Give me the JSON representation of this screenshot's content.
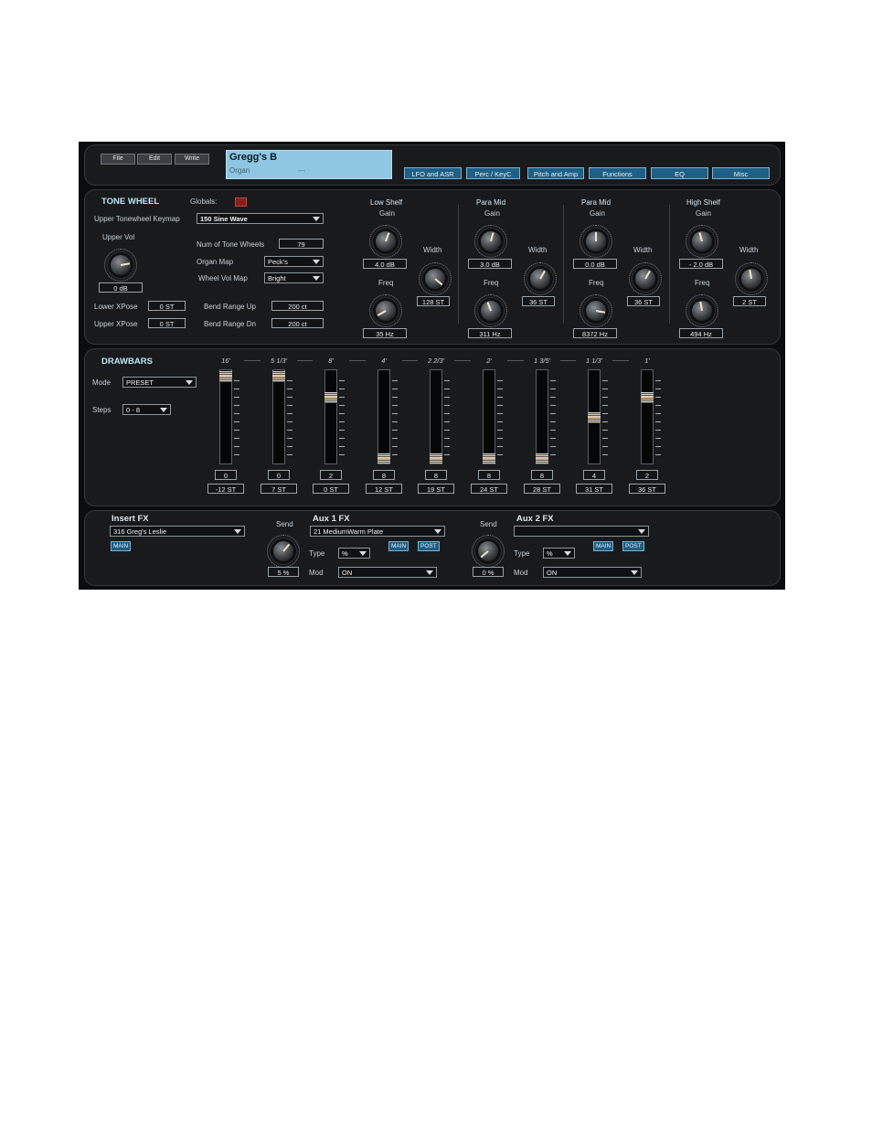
{
  "toolbar": {
    "file": "File",
    "edit": "Edit",
    "write": "Write",
    "patch_name": "Gregg's B",
    "patch_category": "Organ",
    "patch_extra": "---",
    "tabs": [
      "LFO and ASR",
      "Perc / KeyC",
      "Pitch and Amp",
      "Functions",
      "EQ",
      "Misc"
    ]
  },
  "tone_wheel": {
    "title": "TONE WHEEL",
    "globals": "Globals:",
    "keymap_label": "Upper Tonewheel Keymap",
    "keymap_value": "150 Sine Wave",
    "upper_vol_label": "Upper Vol",
    "upper_vol_value": "0 dB",
    "num_wheels_label": "Num of Tone Wheels",
    "num_wheels_value": "79",
    "organ_map_label": "Organ Map",
    "organ_map_value": "Peck's",
    "wheel_vol_label": "Wheel Vol Map",
    "wheel_vol_value": "Bright",
    "lower_xpose_label": "Lower XPose",
    "lower_xpose_value": "0 ST",
    "upper_xpose_label": "Upper XPose",
    "upper_xpose_value": "0 ST",
    "bend_up_label": "Bend Range Up",
    "bend_up_value": "200 ct",
    "bend_dn_label": "Bend Range Dn",
    "bend_dn_value": "200 ct"
  },
  "eq": {
    "bands": [
      {
        "name": "Low Shelf",
        "gain_label": "Gain",
        "gain": "4.0 dB",
        "width_label": "Width",
        "width": "128 ST",
        "freq_label": "Freq",
        "freq": "35 Hz"
      },
      {
        "name": "Para Mid",
        "gain_label": "Gain",
        "gain": "3.0 dB",
        "width_label": "Width",
        "width": "36 ST",
        "freq_label": "Freq",
        "freq": "311 Hz"
      },
      {
        "name": "Para Mid",
        "gain_label": "Gain",
        "gain": "0.0 dB",
        "width_label": "Width",
        "width": "36 ST",
        "freq_label": "Freq",
        "freq": "8372 Hz"
      },
      {
        "name": "High Shelf",
        "gain_label": "Gain",
        "gain": "- 2.0 dB",
        "width_label": "Width",
        "width": "2 ST",
        "freq_label": "Freq",
        "freq": "494 Hz"
      }
    ]
  },
  "drawbars": {
    "title": "DRAWBARS",
    "mode_label": "Mode",
    "mode_value": "PRESET",
    "steps_label": "Steps",
    "steps_value": "0 - 8",
    "bars": [
      {
        "footage": "16'",
        "value": "0",
        "pitch": "-12 ST",
        "level": 0
      },
      {
        "footage": "5 1/3'",
        "value": "0",
        "pitch": "7 ST",
        "level": 0
      },
      {
        "footage": "8'",
        "value": "2",
        "pitch": "0 ST",
        "level": 2
      },
      {
        "footage": "4'",
        "value": "8",
        "pitch": "12 ST",
        "level": 8
      },
      {
        "footage": "2 2/3'",
        "value": "8",
        "pitch": "19 ST",
        "level": 8
      },
      {
        "footage": "2'",
        "value": "8",
        "pitch": "24 ST",
        "level": 8
      },
      {
        "footage": "1 3/5'",
        "value": "8",
        "pitch": "28 ST",
        "level": 8
      },
      {
        "footage": "1 1/3'",
        "value": "4",
        "pitch": "31 ST",
        "level": 4
      },
      {
        "footage": "1'",
        "value": "2",
        "pitch": "36 ST",
        "level": 2
      }
    ]
  },
  "fx": {
    "insert_title": "Insert FX",
    "insert_value": "316  Greg's Leslie",
    "insert_tag": "MAIN",
    "aux1_title": "Aux 1 FX",
    "aux1_value": "21  MediumWarm Plate",
    "aux1_send_label": "Send",
    "aux1_send": "5 %",
    "aux1_type_label": "Type",
    "aux1_type": "%",
    "aux1_mod_label": "Mod",
    "aux1_mod": "ON",
    "aux1_main": "MAIN",
    "aux1_post": "POST",
    "aux2_title": "Aux 2 FX",
    "aux2_value": "",
    "aux2_send_label": "Send",
    "aux2_send": "0 %",
    "aux2_type_label": "Type",
    "aux2_type": "%",
    "aux2_mod_label": "Mod",
    "aux2_mod": "ON",
    "aux2_main": "MAIN",
    "aux2_post": "POST"
  },
  "colors": {
    "accent": "#1e5f85",
    "display": "#8fc6e2",
    "header": "#bfe6f6",
    "led": "#8b1d17"
  }
}
